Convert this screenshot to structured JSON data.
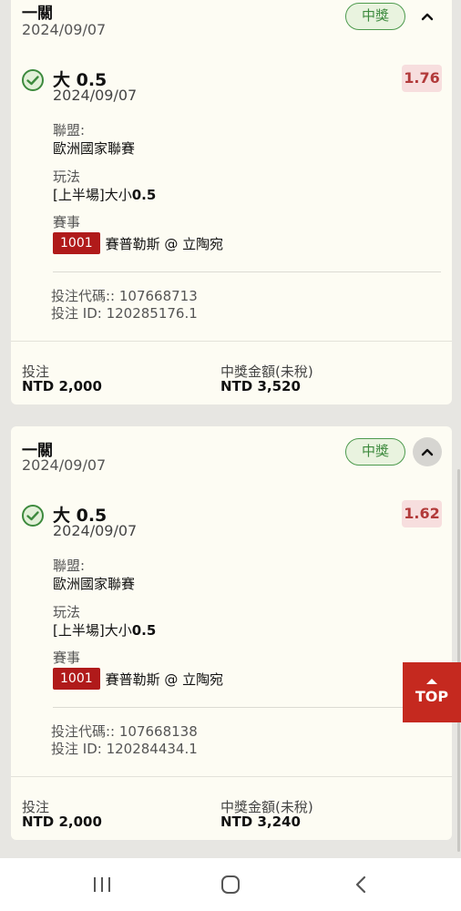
{
  "cards": [
    {
      "title": "一關",
      "date": "2024/09/07",
      "status": "中獎",
      "pick": "大 0.5",
      "pick_date": "2024/09/07",
      "odds": "1.76",
      "league_label": "聯盟:",
      "league": "歐洲國家聯賽",
      "play_label": "玩法",
      "play_prefix": "[上半場]大小",
      "play_value": "0.5",
      "event_label": "賽事",
      "event_code": "1001",
      "event_name": "賽普勒斯 @ 立陶宛",
      "bet_code": "投注代碼:: 107668713",
      "bet_id": "投注 ID: 120285176.1",
      "stake_label": "投注",
      "stake": "NTD 2,000",
      "payout_label": "中獎金額(未稅)",
      "payout": "NTD 3,520"
    },
    {
      "title": "一關",
      "date": "2024/09/07",
      "status": "中獎",
      "pick": "大 0.5",
      "pick_date": "2024/09/07",
      "odds": "1.62",
      "league_label": "聯盟:",
      "league": "歐洲國家聯賽",
      "play_label": "玩法",
      "play_prefix": "[上半場]大小",
      "play_value": "0.5",
      "event_label": "賽事",
      "event_code": "1001",
      "event_name": "賽普勒斯 @ 立陶宛",
      "bet_code": "投注代碼:: 107668138",
      "bet_id": "投注 ID: 120284434.1",
      "stake_label": "投注",
      "stake": "NTD 2,000",
      "payout_label": "中獎金額(未稅)",
      "payout": "NTD 3,240"
    }
  ],
  "top_button": "TOP",
  "icons": {
    "check": "check-circle-icon",
    "collapse": "chevron-up-icon",
    "back_to_top": "arrow-up-icon",
    "nav_recent": "recent-apps-icon",
    "nav_home": "home-icon",
    "nav_back": "back-icon"
  },
  "colors": {
    "win_green": "#3d8a3d",
    "odds_red": "#b23a3a",
    "event_red": "#b01a1a",
    "top_red": "#c5291f",
    "card_bg": "#fdfcf3"
  }
}
